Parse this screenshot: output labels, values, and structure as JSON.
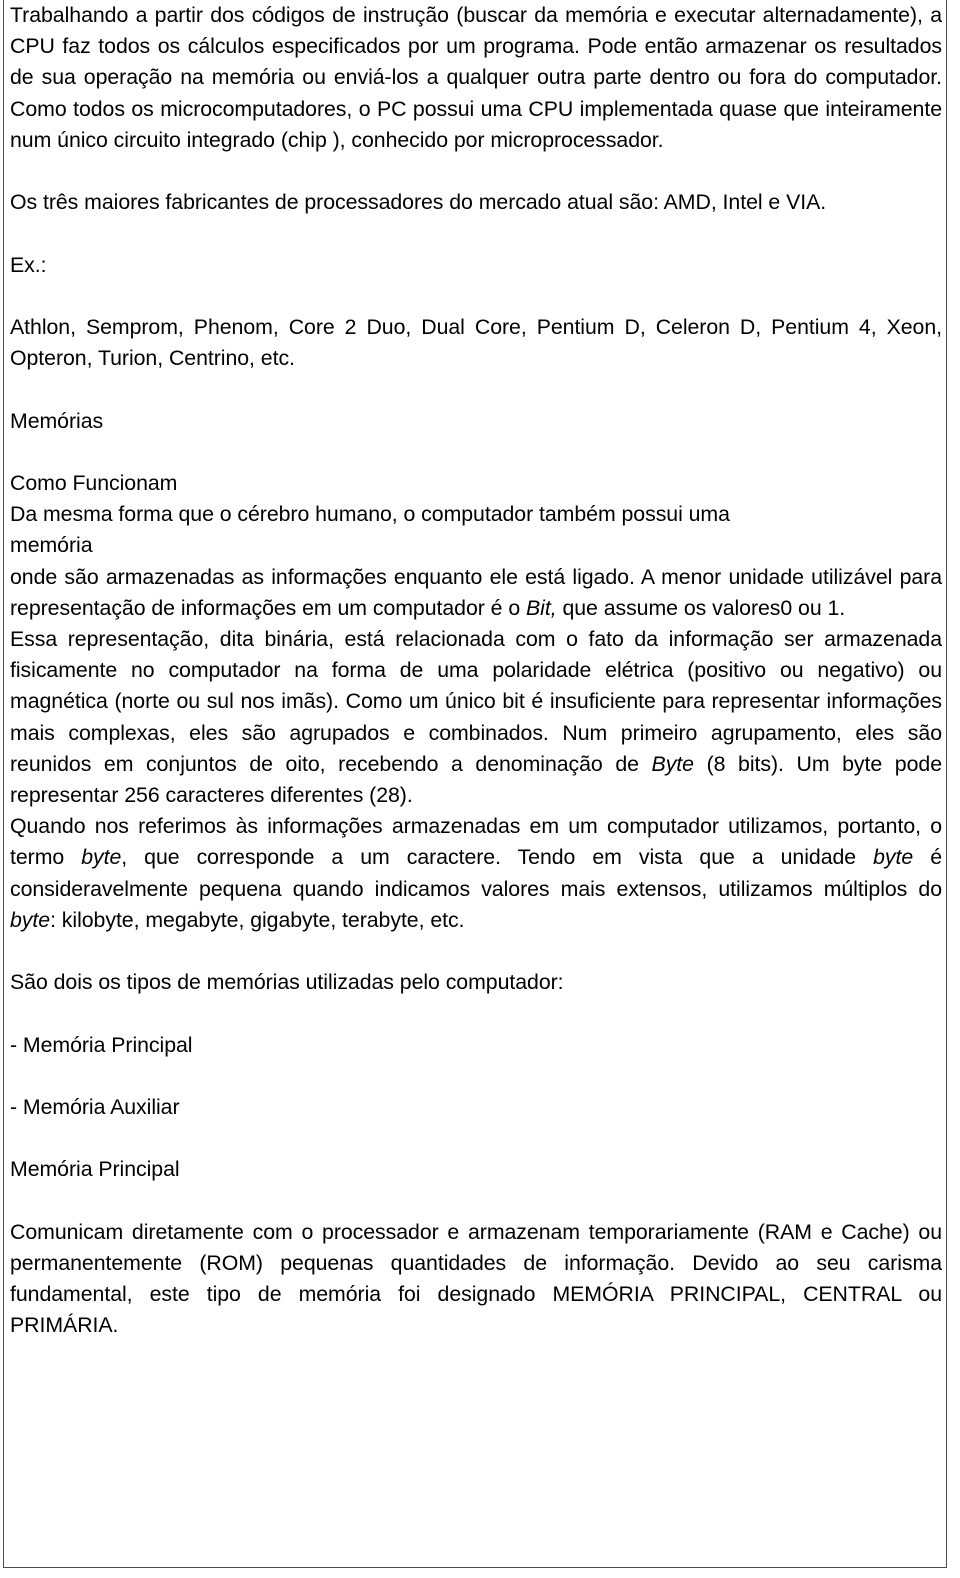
{
  "document": {
    "language": "pt-BR",
    "page_background": "#ffffff",
    "text_color": "#000000",
    "frame_color": "#4d4d4d",
    "blocks": [
      {
        "id": "cpu-intro",
        "name": "paragraph-cpu-intro",
        "align": "justify",
        "text": "Trabalhando a partir dos códigos de instrução (buscar da memória e executar alternadamente), a CPU faz todos os cálculos especificados por um programa. Pode então armazenar os resultados de sua operação na memória ou enviá-los a qualquer outra parte dentro ou fora do computador. Como todos os microcomputadores, o PC possui uma CPU implementada quase que inteiramente num único circuito integrado (chip ), conhecido por microprocessador."
      },
      {
        "id": "fabricantes",
        "name": "paragraph-fabricantes",
        "align": "justify",
        "text": "Os três maiores fabricantes de processadores do mercado atual são: AMD, Intel e VIA."
      },
      {
        "id": "ex-label",
        "name": "paragraph-exemplo-label",
        "align": "left",
        "text": "Ex.:"
      },
      {
        "id": "ex-list",
        "name": "paragraph-exemplo-lista",
        "align": "justify",
        "text": "Athlon, Semprom, Phenom, Core 2 Duo, Dual Core, Pentium D, Celeron D, Pentium 4, Xeon, Opteron, Turion, Centrino, etc."
      },
      {
        "id": "heading-memorias",
        "name": "heading-memorias",
        "align": "left",
        "text": "Memórias"
      },
      {
        "id": "heading-como-funcionam",
        "name": "heading-como-funcionam",
        "align": "left",
        "text": "Como Funcionam"
      },
      {
        "id": "memoria-cerebro",
        "name": "paragraph-memoria-cerebro",
        "align": "left",
        "text": "Da mesma forma que o cérebro humano, o computador também possui uma"
      },
      {
        "id": "memoria-word",
        "name": "paragraph-memoria-word",
        "align": "left",
        "text": "memória"
      },
      {
        "id": "bit-def",
        "name": "paragraph-bit-definicao",
        "align": "justify",
        "segments": [
          {
            "type": "text",
            "value": "onde são armazenadas as informações enquanto ele está ligado. A menor unidade utilizável para representação de informações em um computador é o "
          },
          {
            "type": "italic",
            "value": "Bit,"
          },
          {
            "type": "text",
            "value": " que assume os valores0 ou 1."
          }
        ]
      },
      {
        "id": "binaria",
        "name": "paragraph-representacao-binaria",
        "align": "justify",
        "segments": [
          {
            "type": "text",
            "value": "Essa representação, dita binária, está relacionada com o fato da informação ser armazenada fisicamente no computador na forma de uma polaridade elétrica (positivo ou negativo) ou magnética (norte ou sul nos imãs). Como um único bit é insuficiente para representar informações mais complexas, eles são agrupados e combinados. Num primeiro agrupamento, eles são reunidos em conjuntos de oito, recebendo a denominação de "
          },
          {
            "type": "italic",
            "value": "Byte"
          },
          {
            "type": "text",
            "value": " (8 bits). Um byte pode representar 256 caracteres diferentes (28)."
          }
        ]
      },
      {
        "id": "byte-multiplos",
        "name": "paragraph-byte-multiplos",
        "align": "justify",
        "segments": [
          {
            "type": "text",
            "value": "Quando nos referimos às informações armazenadas em um computador utilizamos, portanto, o termo "
          },
          {
            "type": "italic",
            "value": "byte"
          },
          {
            "type": "text",
            "value": ", que corresponde a um caractere. Tendo em vista que a unidade "
          },
          {
            "type": "italic",
            "value": "byte"
          },
          {
            "type": "text",
            "value": " é consideravelmente pequena quando indicamos valores mais extensos, utilizamos múltiplos do "
          },
          {
            "type": "italic",
            "value": "byte"
          },
          {
            "type": "text",
            "value": ": kilobyte, megabyte, gigabyte, terabyte, etc."
          }
        ]
      },
      {
        "id": "tipos-intro",
        "name": "paragraph-tipos-memoria-intro",
        "align": "left",
        "text": "São dois os tipos de memórias utilizadas pelo computador:"
      },
      {
        "id": "tipo-principal",
        "name": "list-item-memoria-principal",
        "align": "left",
        "text": "- Memória Principal"
      },
      {
        "id": "tipo-auxiliar",
        "name": "list-item-memoria-auxiliar",
        "align": "left",
        "text": "- Memória Auxiliar"
      },
      {
        "id": "heading-memoria-principal",
        "name": "heading-memoria-principal",
        "align": "left",
        "text": "Memória Principal"
      },
      {
        "id": "memoria-principal-desc",
        "name": "paragraph-memoria-principal-descricao",
        "align": "justify",
        "text": "Comunicam diretamente com o processador e armazenam temporariamente (RAM e Cache) ou permanentemente (ROM) pequenas quantidades de informação. Devido ao seu carisma  fundamental, este tipo de memória foi designado MEMÓRIA PRINCIPAL, CENTRAL ou PRIMÁRIA."
      }
    ]
  }
}
